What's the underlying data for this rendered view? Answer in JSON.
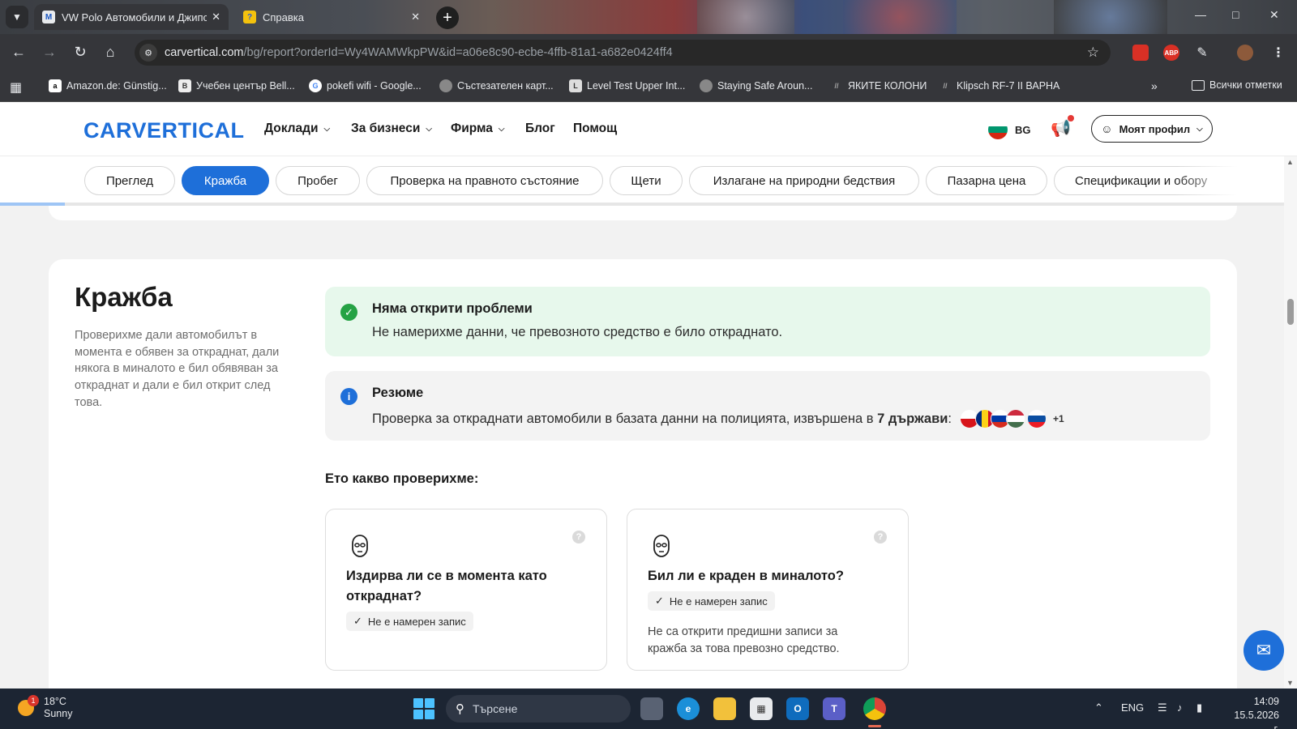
{
  "browser": {
    "tabs": [
      {
        "title": "VW Polo Автомобили и Джипс",
        "active": true
      },
      {
        "title": "Справка",
        "active": false
      }
    ],
    "url_host": "carvertical.com",
    "url_path": "/bg/report?orderId=Wy4WAMWkpPW&id=a06e8c90-ecbe-4ffb-81a1-a682e0424ff4",
    "bookmarks": [
      "Amazon.de: Günstig...",
      "Учебен център Bell...",
      "pokefi wifi - Google...",
      "Състезателен карт...",
      "Level Test Upper Int...",
      "Staying Safe Aroun...",
      "ЯКИТЕ КОЛОНИ",
      "Klipsch RF-7 II ВАРНА"
    ],
    "all_bookmarks": "Всички отметки",
    "ext_abp": "ABP"
  },
  "site": {
    "logo": "CARVERTICAL",
    "nav": [
      "Доклади",
      "За бизнеси",
      "Фирма",
      "Блог",
      "Помощ"
    ],
    "lang": "BG",
    "profile": "Моят профил",
    "subnav": [
      "Преглед",
      "Кражба",
      "Пробег",
      "Проверка на правното състояние",
      "Щети",
      "Излагане на природни бедствия",
      "Пазарна цена",
      "Спецификации и обору"
    ],
    "active_subnav": "Кражба",
    "section_progress": 0.05
  },
  "section": {
    "title": "Кражба",
    "description": "Проверихме дали автомобилът в момента е обявен за откраднат, дали някога в миналото е бил обявяван за откраднат и дали е бил открит след това.",
    "ok_alert": {
      "heading": "Няма открити проблеми",
      "text": "Не намерихме данни, че превозното средство е било откраднато."
    },
    "summary": {
      "heading": "Резюме",
      "text_before": "Проверка за откраднати автомобили в базата данни на полицията, извършена в",
      "countries": "7 държави",
      "colon": ":",
      "more": "+1"
    },
    "checked_title": "Ето какво проверихме:",
    "checks": [
      {
        "question": "Издирва ли се в момента като откраднат?",
        "badge": "Не е намерен запис",
        "note": ""
      },
      {
        "question": "Бил ли е краден в миналото?",
        "badge": "Не е намерен запис",
        "note": "Не са открити предишни записи за кражба за това превозно средство."
      }
    ]
  },
  "taskbar": {
    "weather_temp": "18°C",
    "weather_desc": "Sunny",
    "weather_badge": "1",
    "search_placeholder": "Търсене",
    "lang": "ENG",
    "time": "14:09",
    "date": "15.5.2026 г."
  },
  "colors": {
    "brand_blue": "#1e6fd9",
    "ok_green": "#25a244",
    "info_blue": "#1e6fd9"
  }
}
